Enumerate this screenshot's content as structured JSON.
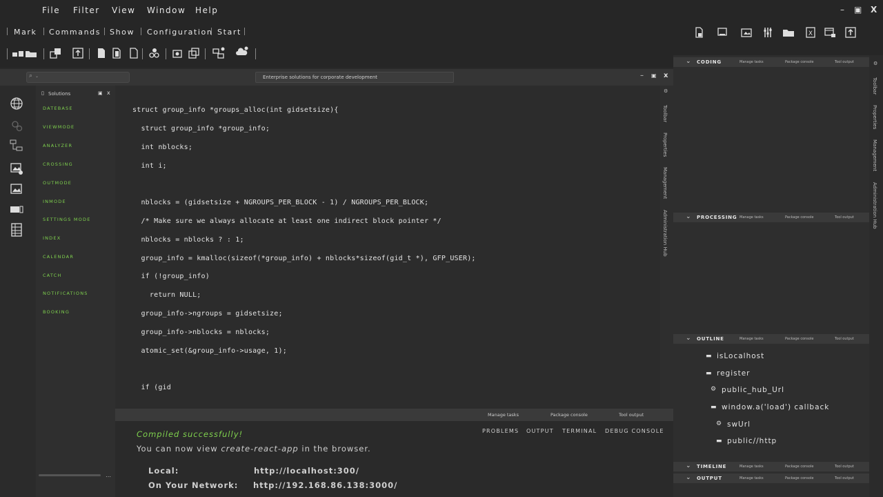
{
  "menu": [
    "File",
    "Filter",
    "View",
    "Window",
    "Help"
  ],
  "window_controls": {
    "minimize": "–",
    "maximize": "▣",
    "close": "X"
  },
  "commands": [
    "Mark",
    "Commands",
    "Show",
    "Configuration",
    "Start"
  ],
  "search": {
    "placeholder": ""
  },
  "document_title": "Enterprise solutions for corporate development",
  "editor_controls": {
    "minimize": "–",
    "maximize": "▣",
    "close": "x"
  },
  "solutions": {
    "title": "Solutions",
    "items": [
      "DATEBASE",
      "VIEWMODE",
      "ANALYZER",
      "CROSSING",
      "OUTMODE",
      "INMODE",
      "SETTINGS MODE",
      "INDEX",
      "CALENDAR",
      "CATCH",
      "NOTIFICATIONS",
      "BOOKING"
    ]
  },
  "code_lines": [
    "struct group_info *groups_alloc(int gidsetsize){",
    "  struct group_info *group_info;",
    "  int nblocks;",
    "  int i;",
    "",
    "  nblocks = (gidsetsize + NGROUPS_PER_BLOCK - 1) / NGROUPS_PER_BLOCK;",
    "  /* Make sure we always allocate at least one indirect block pointer */",
    "  nblocks = nblocks ? : 1;",
    "  group_info = kmalloc(sizeof(*group_info) + nblocks*sizeof(gid_t *), GFP_USER);",
    "  if (!group_info)",
    "    return NULL;",
    "  group_info->ngroups = gidsetsize;",
    "  group_info->nblocks = nblocks;",
    "  atomic_set(&group_info->usage, 1);",
    "",
    "  if (gid"
  ],
  "side_tabs": [
    "Toolbar",
    "Properties",
    "Management",
    "Administration Hub"
  ],
  "panel_links": {
    "manage": "Manage tasks",
    "package": "Package console",
    "tool": "Tool output"
  },
  "terminal": {
    "tabs": [
      "PROBLEMS",
      "OUTPUT",
      "TERMINAL",
      "DEBUG CONSOLE"
    ],
    "compiled": "Compiled successfully!",
    "line2_a": "You can now view ",
    "line2_b": "create-react-app",
    "line2_c": " in the browser.",
    "local_label": "Local:",
    "local_url": "http://localhost:300/",
    "network_label": "On Your Network:",
    "network_url": "http://192.168.86.138:3000/"
  },
  "right_panels": {
    "coding": "CODING",
    "processing": "PROCESSING",
    "outline": "OUTLINE",
    "timeline": "TIMELINE",
    "output": "OUTPUT",
    "outline_items": [
      "isLocalhost",
      "register",
      "public_hub_Url",
      "window.a('load') callback",
      "swUrl",
      "public//http"
    ]
  },
  "colors": {
    "accent_green": "#7fd14e",
    "background": "#2a2a2a"
  }
}
